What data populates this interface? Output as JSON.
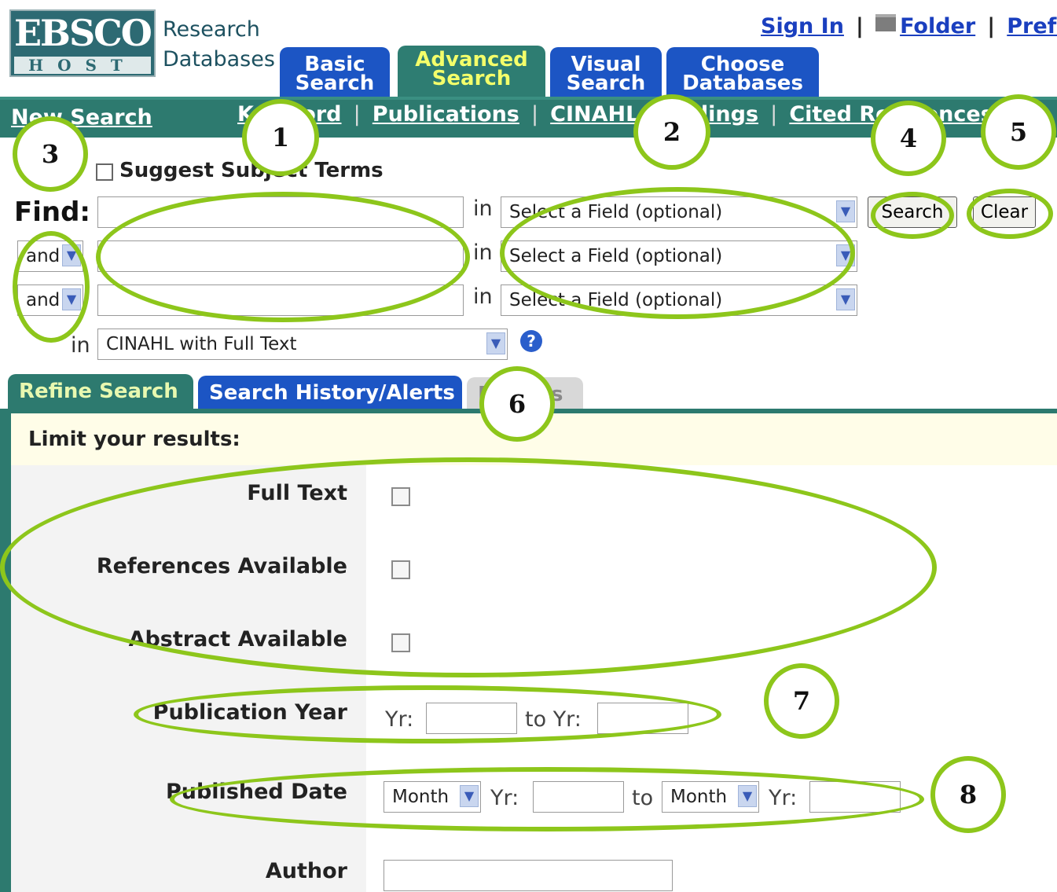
{
  "brand": {
    "logo_top": "EBSCO",
    "logo_bottom": "HOST",
    "line1": "Research",
    "line2": "Databases"
  },
  "toplinks": {
    "sign_in": "Sign In",
    "sep1": "|",
    "folder": "Folder",
    "sep2": "|",
    "preferences": "Prefe"
  },
  "tabs": [
    {
      "line1": "Basic",
      "line2": "Search"
    },
    {
      "line1": "Advanced",
      "line2": "Search"
    },
    {
      "line1": "Visual",
      "line2": "Search"
    },
    {
      "line1": "Choose",
      "line2": "Databases"
    }
  ],
  "nav": {
    "new_search": "New Search",
    "keyword": "Keyword",
    "publications": "Publications",
    "cinahl_headings": "CINAHL Headings",
    "cited_references": "Cited References",
    "sep": "|"
  },
  "suggest": {
    "label": "Suggest Subject Terms"
  },
  "find": {
    "label": "Find:",
    "in": "in",
    "field_placeholder": "Select a Field (optional)",
    "operator": "and",
    "search_button": "Search",
    "clear_button": "Clear",
    "database": "CINAHL with Full Text",
    "help": "?"
  },
  "lower_tabs": {
    "refine": "Refine Search",
    "history": "Search History/Alerts",
    "results": "Results"
  },
  "limits": {
    "heading": "Limit your results:",
    "full_text": "Full Text",
    "references": "References Available",
    "abstract": "Abstract Available",
    "pub_year": "Publication Year",
    "yr": "Yr:",
    "to_yr": "to Yr:",
    "pub_date": "Published Date",
    "month": "Month",
    "to": "to",
    "author": "Author"
  },
  "annotations": [
    "1",
    "2",
    "3",
    "4",
    "5",
    "6",
    "7",
    "8"
  ],
  "colors": {
    "accent_green": "#8dc61b",
    "nav_teal": "#2d7a6f",
    "tab_blue": "#1c55c4",
    "link_blue": "#1a3fbf"
  }
}
